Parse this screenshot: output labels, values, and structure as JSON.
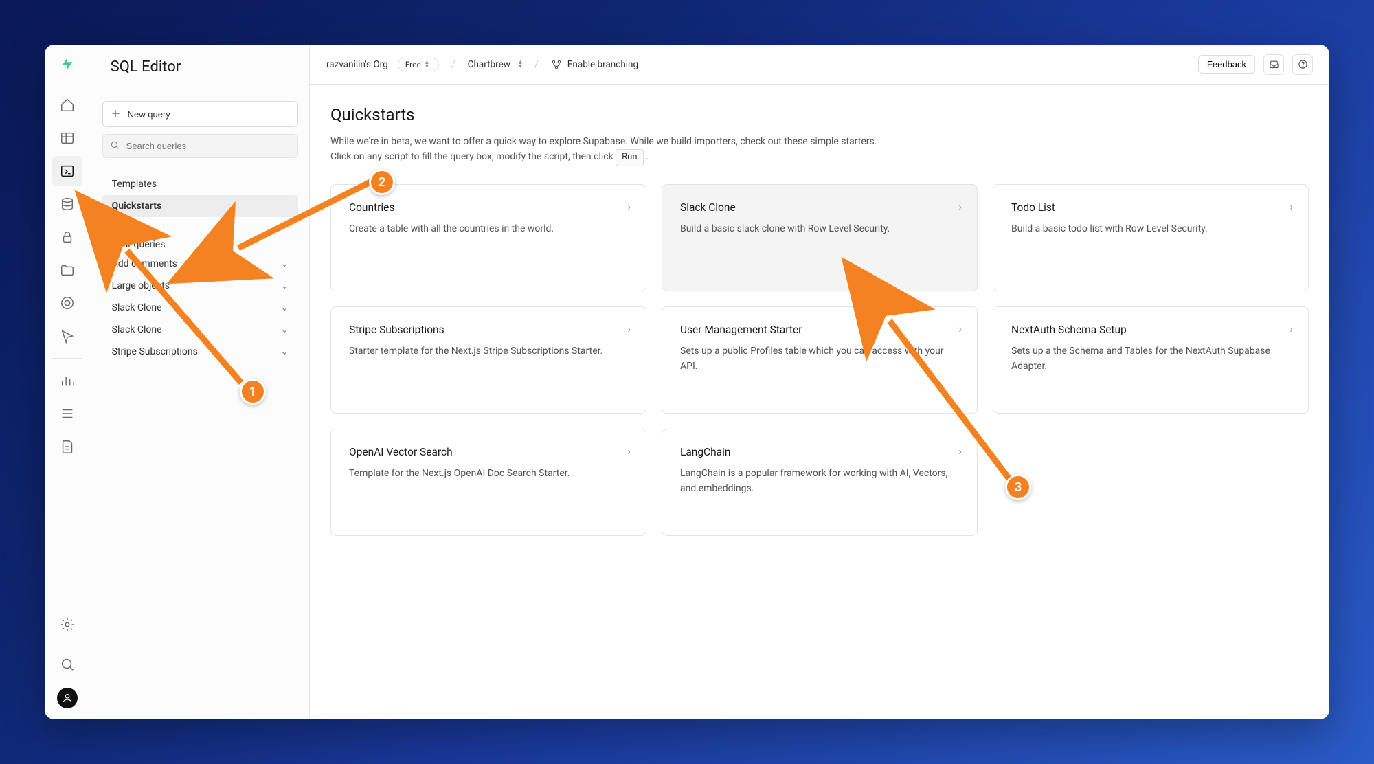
{
  "sidebar_title": "SQL Editor",
  "new_query_label": "New query",
  "search_placeholder": "Search queries",
  "sb_templates": "Templates",
  "sb_quickstarts": "Quickstarts",
  "sb_your_queries": "Your queries",
  "queries": [
    "Add comments",
    "Large objects",
    "Slack Clone",
    "Slack Clone",
    "Stripe Subscriptions"
  ],
  "breadcrumb": {
    "org": "razvanilin's Org",
    "plan": "Free",
    "project": "Chartbrew",
    "branching": "Enable branching"
  },
  "feedback": "Feedback",
  "page_title": "Quickstarts",
  "intro_line1": "While we're in beta, we want to offer a quick way to explore Supabase. While we build importers, check out these simple starters.",
  "intro_line2a": "Click on any script to fill the query box, modify the script, then click ",
  "intro_run": "Run",
  "intro_line2b": " .",
  "cards": [
    {
      "title": "Countries",
      "desc": "Create a table with all the countries in the world."
    },
    {
      "title": "Slack Clone",
      "desc": "Build a basic slack clone with Row Level Security."
    },
    {
      "title": "Todo List",
      "desc": "Build a basic todo list with Row Level Security."
    },
    {
      "title": "Stripe Subscriptions",
      "desc": "Starter template for the Next.js Stripe Subscriptions Starter."
    },
    {
      "title": "User Management Starter",
      "desc": "Sets up a public Profiles table which you can access with your API."
    },
    {
      "title": "NextAuth Schema Setup",
      "desc": "Sets up a the Schema and Tables for the NextAuth Supabase Adapter."
    },
    {
      "title": "OpenAI Vector Search",
      "desc": "Template for the Next.js OpenAI Doc Search Starter."
    },
    {
      "title": "LangChain",
      "desc": "LangChain is a popular framework for working with AI, Vectors, and embeddings."
    }
  ],
  "annotations": {
    "a1": "1",
    "a2": "2",
    "a3": "3"
  }
}
